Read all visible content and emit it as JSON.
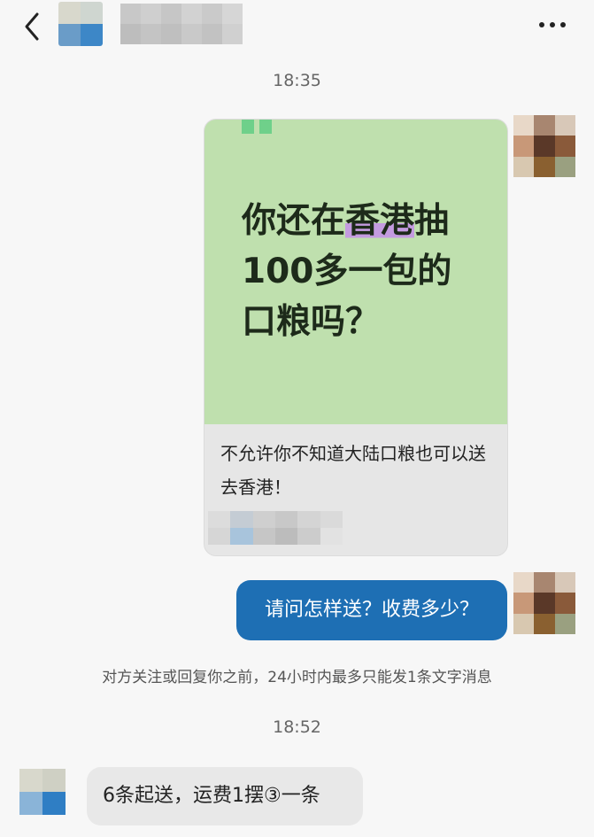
{
  "header": {
    "back_icon": "chevron-left-icon",
    "more_icon": "ellipsis-horizontal-icon"
  },
  "messages": {
    "timestamp_1": "18:35",
    "card": {
      "headline_pre": "你还在",
      "headline_highlight": "香港",
      "headline_post": "抽\n100多一包的\n口粮吗？",
      "description": "不允许你不知道大陆口粮也可以送去香港！"
    },
    "outgoing_text": "请问怎样送？收费多少？",
    "notice": "对方关注或回复你之前，24小时内最多只能发1条文字消息",
    "timestamp_2": "18:52",
    "incoming_text": "6条起送，运费1摆③一条"
  },
  "colors": {
    "outgoing_bubble": "#1e6fb4",
    "incoming_bubble": "#e8e8e8",
    "card_image_bg": "#bfe0ae",
    "highlight": "#c49be0",
    "background": "#f7f7f7"
  }
}
